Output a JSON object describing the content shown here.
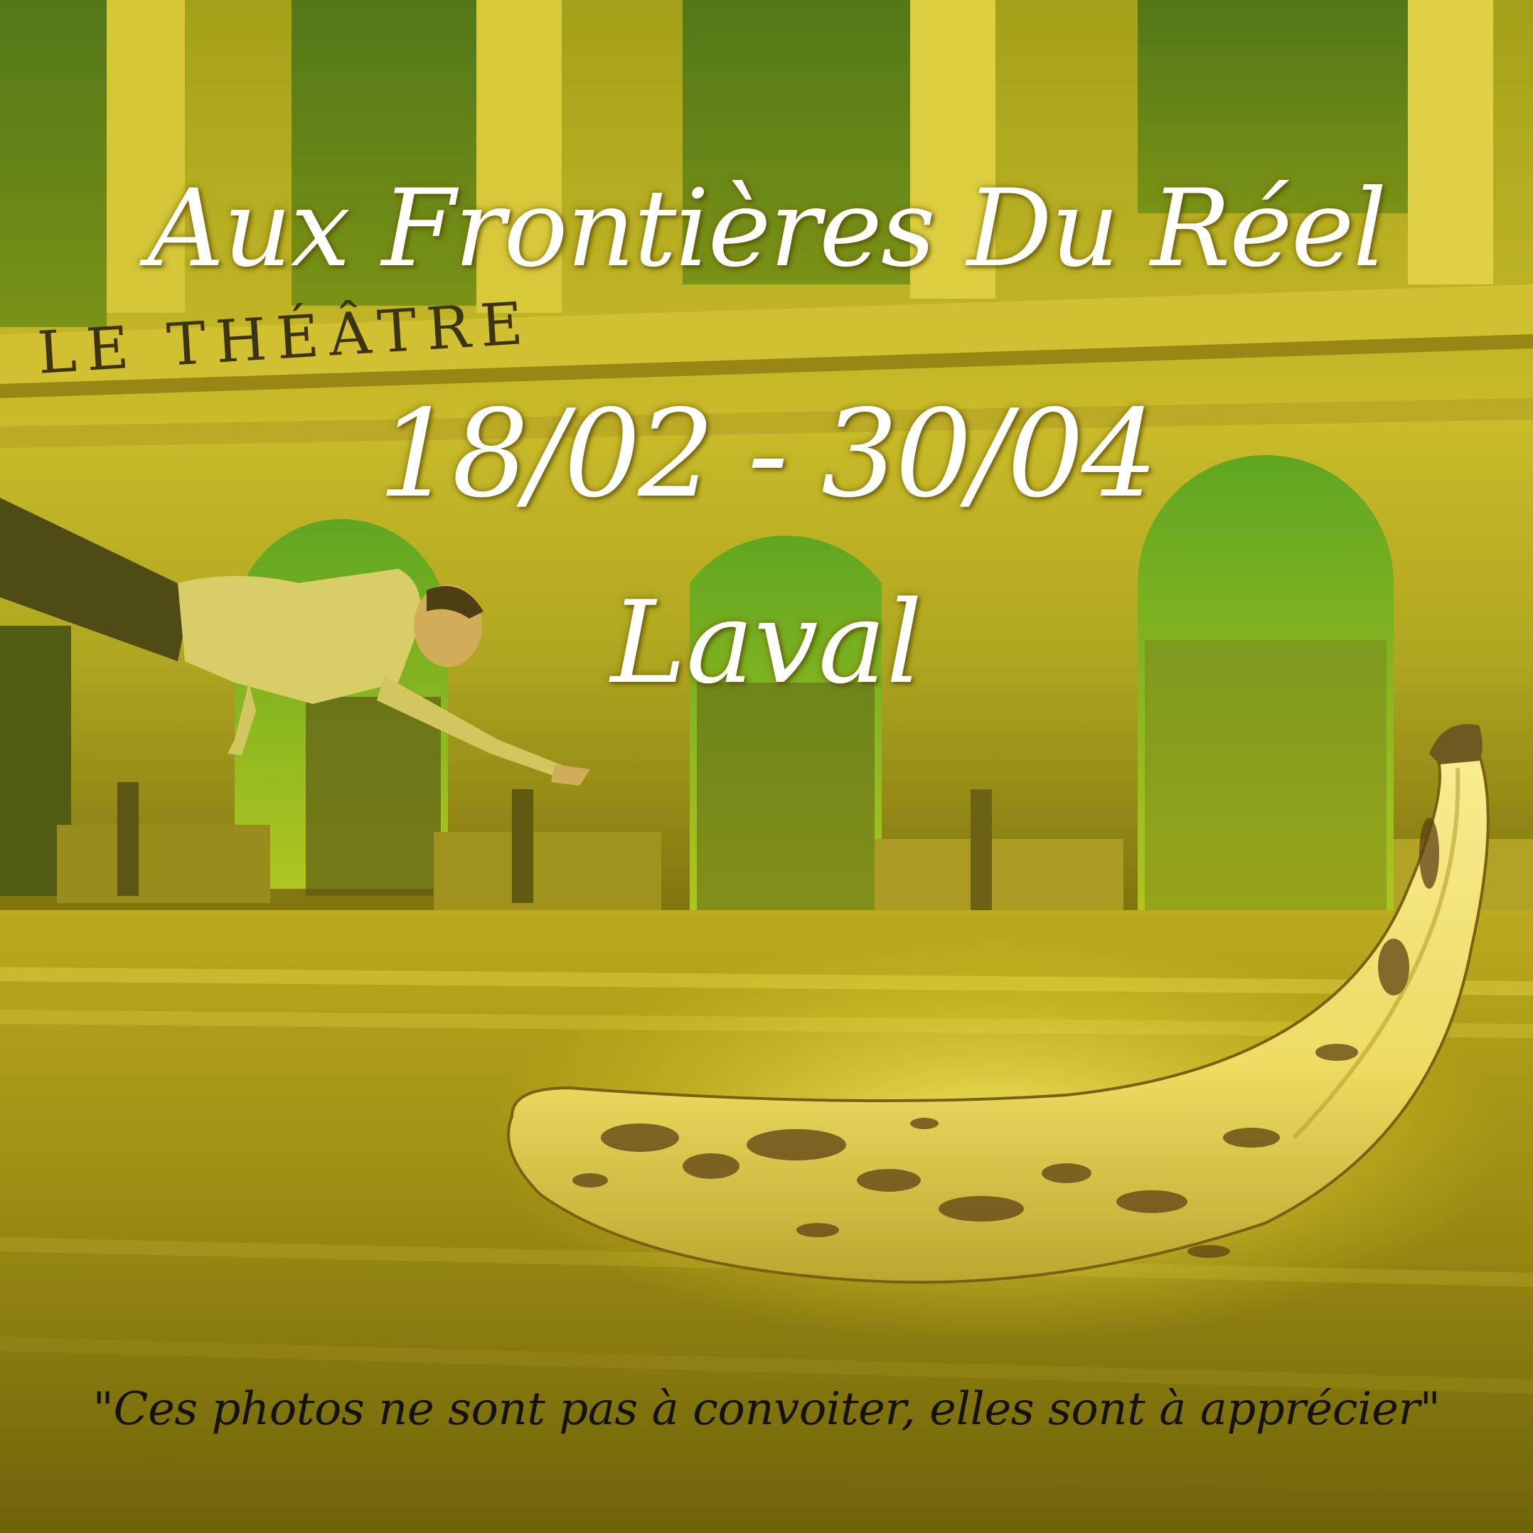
{
  "poster": {
    "title": "Aux Frontières Du Réel",
    "dates": "18/02 - 30/04",
    "city": "Laval",
    "quote": "\"Ces photos ne sont pas à convoiter, elles sont à apprécier\""
  },
  "scene": {
    "building_sign": "LE THÉÂTRE",
    "tint_color": "#d8c82a",
    "banana_color": "#f2e27a",
    "spot_color": "#4a2e12"
  }
}
